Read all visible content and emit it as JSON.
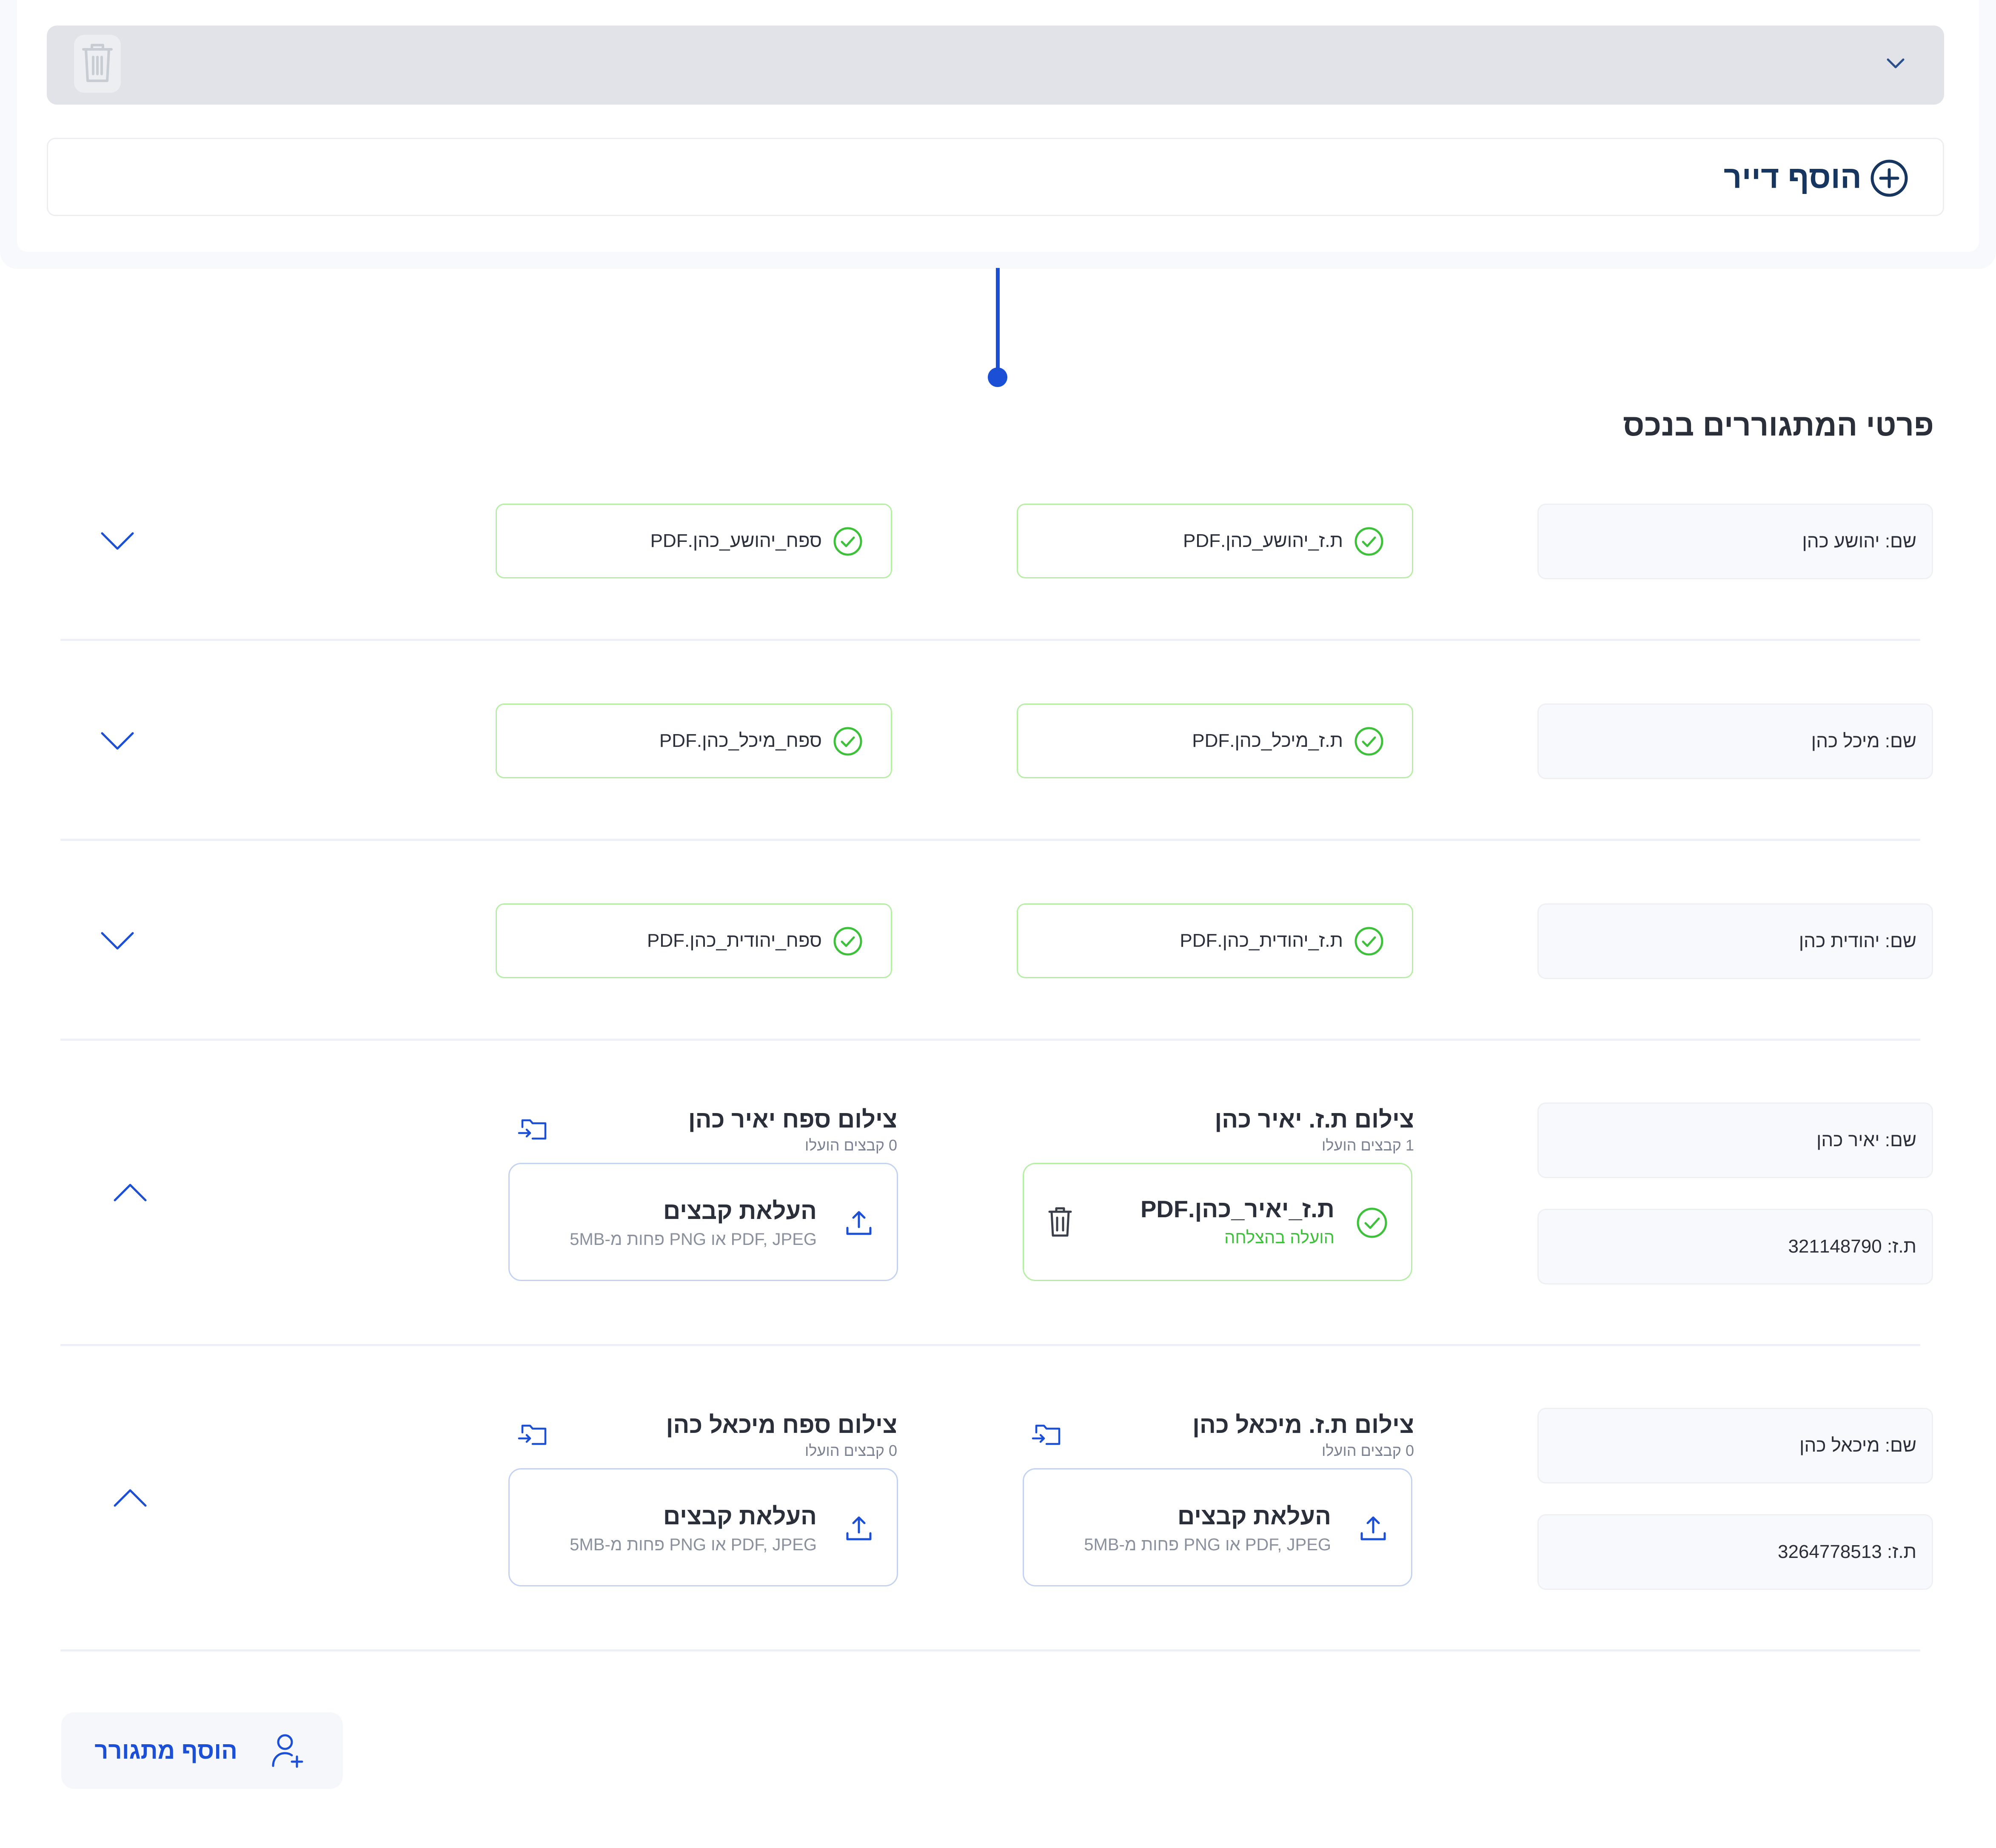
{
  "tenant_card": {
    "add_tenant_label": "הוסף דייר"
  },
  "section": {
    "title": "פרטי המתגוררים בנכס"
  },
  "residents": [
    {
      "name": "שם: יהושע כהן",
      "id_file": "ת.ז_יהושע_כהן.PDF",
      "appendix_file": "ספח_יהושע_כהן.PDF",
      "expanded": false
    },
    {
      "name": "שם: מיכל כהן",
      "id_file": "ת.ז_מיכל_כהן.PDF",
      "appendix_file": "ספח_מיכל_כהן.PDF",
      "expanded": false
    },
    {
      "name": "שם: יהודית כהן",
      "id_file": "ת.ז_יהודית_כהן.PDF",
      "appendix_file": "ספח_יהודית_כהן.PDF",
      "expanded": false
    },
    {
      "name": "שם: יאיר כהן",
      "id_number": "ת.ז: 321148790",
      "expanded": true,
      "id_upload": {
        "title": "צילום ת.ז. יאיר כהן",
        "count": "1 קבצים הועלו",
        "file_name": "ת.ז_יאיר_כהן.PDF",
        "file_status": "הועלה בהצלחה"
      },
      "appendix_upload": {
        "title": "צילום ספח יאיר כהן",
        "count": "0 קבצים הועלו",
        "button": "העלאת קבצים",
        "hint": "PDF, JPEG או PNG פחות מ-5MB"
      }
    },
    {
      "name": "שם: מיכאל כהן",
      "id_number": "ת.ז: 3264778513",
      "expanded": true,
      "id_upload": {
        "title": "צילום ת.ז. מיכאל כהן",
        "count": "0 קבצים הועלו",
        "button": "העלאת קבצים",
        "hint": "PDF, JPEG או PNG פחות מ-5MB"
      },
      "appendix_upload": {
        "title": "צילום ספח מיכאל כהן",
        "count": "0 קבצים הועלו",
        "button": "העלאת קבצים",
        "hint": "PDF, JPEG או PNG פחות מ-5MB"
      }
    }
  ],
  "add_resident_label": "הוסף מתגורר",
  "colors": {
    "brand_blue": "#1a4fd6",
    "success_green": "#3ec13a",
    "dark_navy": "#17365f"
  },
  "icons": [
    "trash-icon",
    "chevron-down-icon",
    "plus-circle-icon",
    "check-circle-icon",
    "folder-import-icon",
    "upload-icon",
    "chevron-up-icon",
    "user-plus-icon"
  ]
}
